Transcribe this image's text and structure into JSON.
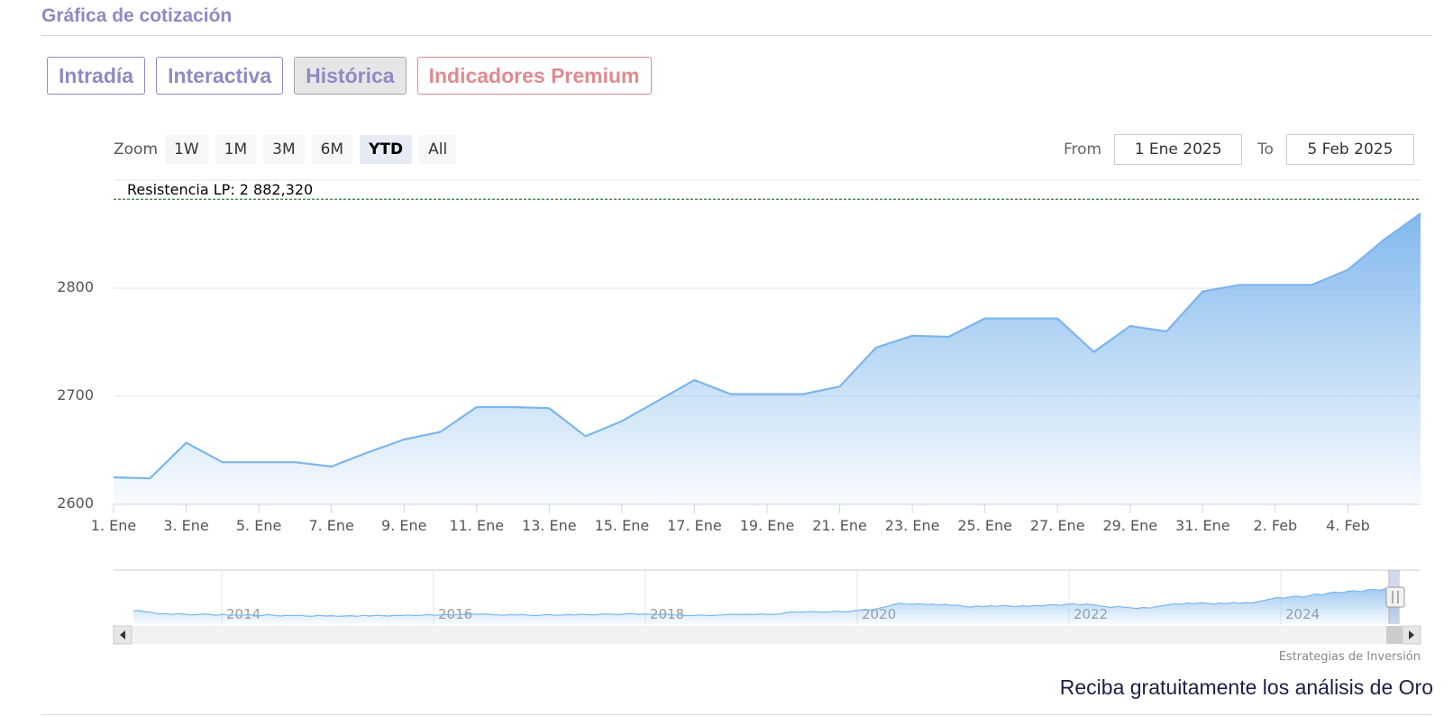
{
  "section_title": "Gráfica de cotización",
  "tabs": [
    {
      "label": "Intradía"
    },
    {
      "label": "Interactiva"
    },
    {
      "label": "Histórica"
    },
    {
      "label": "Indicadores Premium"
    }
  ],
  "zoom": {
    "label": "Zoom",
    "buttons": [
      "1W",
      "1M",
      "3M",
      "6M",
      "YTD",
      "All"
    ],
    "selected": "YTD"
  },
  "range": {
    "from_label": "From",
    "from_value": "1 Ene 2025",
    "to_label": "To",
    "to_value": "5 Feb 2025"
  },
  "credit": "Estrategias de Inversión",
  "footer_text": "Reciba gratuitamente los análisis de Oro",
  "colors": {
    "series": "#7cb5ec",
    "resistance": "#2e7d32",
    "accent": "#8e8ac4",
    "premium": "#df8a91"
  },
  "chart_data": {
    "type": "area",
    "x": [
      "1. Ene",
      "2. Ene",
      "3. Ene",
      "4. Ene",
      "5. Ene",
      "6. Ene",
      "7. Ene",
      "8. Ene",
      "9. Ene",
      "10. Ene",
      "11. Ene",
      "12. Ene",
      "13. Ene",
      "14. Ene",
      "15. Ene",
      "16. Ene",
      "17. Ene",
      "18. Ene",
      "19. Ene",
      "20. Ene",
      "21. Ene",
      "22. Ene",
      "23. Ene",
      "24. Ene",
      "25. Ene",
      "26. Ene",
      "27. Ene",
      "28. Ene",
      "29. Ene",
      "30. Ene",
      "31. Ene",
      "1. Feb",
      "2. Feb",
      "3. Feb",
      "4. Feb",
      "5. Feb"
    ],
    "series": [
      {
        "values": [
          2625,
          2624,
          2657,
          2639,
          2639,
          2639,
          2635,
          2648,
          2660,
          2667,
          2690,
          2690,
          2689,
          2663,
          2677,
          2696,
          2715,
          2702,
          2702,
          2702,
          2709,
          2745,
          2756,
          2755,
          2772,
          2772,
          2772,
          2741,
          2765,
          2760,
          2797,
          2803,
          2803,
          2803,
          2817,
          2845,
          2869
        ]
      }
    ],
    "x_ticks": [
      "1. Ene",
      "3. Ene",
      "5. Ene",
      "7. Ene",
      "9. Ene",
      "11. Ene",
      "13. Ene",
      "15. Ene",
      "17. Ene",
      "19. Ene",
      "21. Ene",
      "23. Ene",
      "25. Ene",
      "27. Ene",
      "29. Ene",
      "31. Ene",
      "2. Feb",
      "4. Feb"
    ],
    "y_ticks": [
      2600,
      2700,
      2800
    ],
    "ylim": [
      2600,
      2900
    ],
    "grid": true,
    "plot_line": {
      "label": "Resistencia LP: 2 882,320",
      "value": 2882.32
    },
    "navigator": {
      "year_labels": [
        "2014",
        "2016",
        "2018",
        "2020",
        "2022",
        "2024"
      ],
      "values": [
        0.23,
        0.24,
        0.2,
        0.18,
        0.14,
        0.15,
        0.12,
        0.15,
        0.13,
        0.11,
        0.12,
        0.14,
        0.12,
        0.1,
        0.13,
        0.1,
        0.11,
        0.1,
        0.12,
        0.1,
        0.09,
        0.12,
        0.1,
        0.08,
        0.1,
        0.09,
        0.1,
        0.08,
        0.07,
        0.1,
        0.08,
        0.09,
        0.07,
        0.08,
        0.09,
        0.07,
        0.1,
        0.08,
        0.1,
        0.09,
        0.08,
        0.1,
        0.09,
        0.11,
        0.09,
        0.1,
        0.12,
        0.1,
        0.11,
        0.12,
        0.1,
        0.13,
        0.12,
        0.14,
        0.13,
        0.14,
        0.12,
        0.11,
        0.1,
        0.12,
        0.11,
        0.12,
        0.1,
        0.09,
        0.11,
        0.12,
        0.1,
        0.11,
        0.12,
        0.11,
        0.13,
        0.12,
        0.11,
        0.13,
        0.14,
        0.13,
        0.12,
        0.14,
        0.15,
        0.13,
        0.14,
        0.13,
        0.12,
        0.14,
        0.12,
        0.11,
        0.1,
        0.09,
        0.1,
        0.11,
        0.09,
        0.1,
        0.11,
        0.12,
        0.13,
        0.12,
        0.13,
        0.12,
        0.14,
        0.13,
        0.12,
        0.14,
        0.17,
        0.2,
        0.19,
        0.2,
        0.21,
        0.2,
        0.19,
        0.2,
        0.22,
        0.2,
        0.21,
        0.24,
        0.26,
        0.25,
        0.28,
        0.32,
        0.36,
        0.42,
        0.45,
        0.43,
        0.42,
        0.44,
        0.41,
        0.43,
        0.4,
        0.42,
        0.39,
        0.4,
        0.36,
        0.34,
        0.37,
        0.35,
        0.38,
        0.36,
        0.39,
        0.37,
        0.35,
        0.38,
        0.36,
        0.39,
        0.37,
        0.4,
        0.41,
        0.39,
        0.42,
        0.44,
        0.4,
        0.43,
        0.41,
        0.38,
        0.36,
        0.33,
        0.36,
        0.34,
        0.32,
        0.3,
        0.33,
        0.31,
        0.35,
        0.38,
        0.41,
        0.44,
        0.42,
        0.46,
        0.44,
        0.47,
        0.45,
        0.43,
        0.46,
        0.44,
        0.48,
        0.45,
        0.47,
        0.46,
        0.5,
        0.54,
        0.58,
        0.62,
        0.6,
        0.64,
        0.66,
        0.63,
        0.67,
        0.72,
        0.7,
        0.75,
        0.78,
        0.76,
        0.8,
        0.82,
        0.79,
        0.84,
        0.86,
        0.83,
        0.88,
        0.9,
        0.92
      ]
    }
  }
}
